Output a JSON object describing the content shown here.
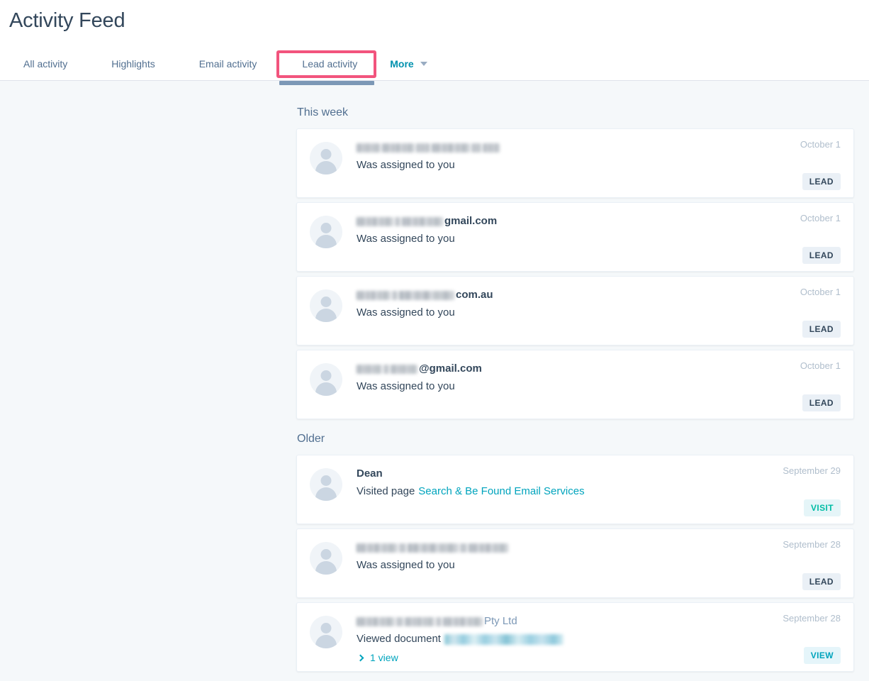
{
  "header": {
    "title": "Activity Feed",
    "tabs": [
      {
        "label": "All activity",
        "name": "tab-all-activity",
        "active": false
      },
      {
        "label": "Highlights",
        "name": "tab-highlights",
        "active": false
      },
      {
        "label": "Email activity",
        "name": "tab-email-activity",
        "active": false
      },
      {
        "label": "Lead activity",
        "name": "tab-lead-activity",
        "active": true
      }
    ],
    "more_label": "More",
    "highlight_color": "#f2547d",
    "active_underline_color": "#7c98b6"
  },
  "groups": [
    {
      "title": "This week",
      "items": [
        {
          "name_redacted": true,
          "name_suffix": "",
          "redact_widths": [
            34,
            46,
            20,
            54,
            14,
            24
          ],
          "action": "Was assigned to you",
          "date": "October 1",
          "badge": "LEAD",
          "badge_type": "lead"
        },
        {
          "name_redacted": true,
          "name_suffix": "gmail.com",
          "redact_widths": [
            52,
            8,
            58
          ],
          "action": "Was assigned to you",
          "date": "October 1",
          "badge": "LEAD",
          "badge_type": "lead"
        },
        {
          "name_redacted": true,
          "name_suffix": "com.au",
          "redact_widths": [
            48,
            8,
            78
          ],
          "action": "Was assigned to you",
          "date": "October 1",
          "badge": "LEAD",
          "badge_type": "lead"
        },
        {
          "name_redacted": true,
          "name_suffix": "@gmail.com",
          "redact_widths": [
            36,
            8,
            38
          ],
          "action": "Was assigned to you",
          "date": "October 1",
          "badge": "LEAD",
          "badge_type": "lead"
        }
      ]
    },
    {
      "title": "Older",
      "items": [
        {
          "name_redacted": false,
          "name": "Dean",
          "action": "Visited page",
          "link_text": "Search & Be Found Email Services",
          "date": "September 29",
          "badge": "VISIT",
          "badge_type": "visit"
        },
        {
          "name_redacted": true,
          "name_suffix": "",
          "redact_widths": [
            58,
            10,
            72,
            10,
            56
          ],
          "action": "Was assigned to you",
          "date": "September 28",
          "badge": "LEAD",
          "badge_type": "lead"
        },
        {
          "name_redacted": true,
          "name_suffix": "Pty Ltd",
          "name_suffix_plain": true,
          "redact_widths": [
            54,
            10,
            42,
            8,
            56
          ],
          "action": "Viewed document",
          "link_redacted": true,
          "link_redact_width": 168,
          "expander_label": "1 view",
          "date": "September 28",
          "badge": "VIEW",
          "badge_type": "view"
        }
      ]
    }
  ]
}
